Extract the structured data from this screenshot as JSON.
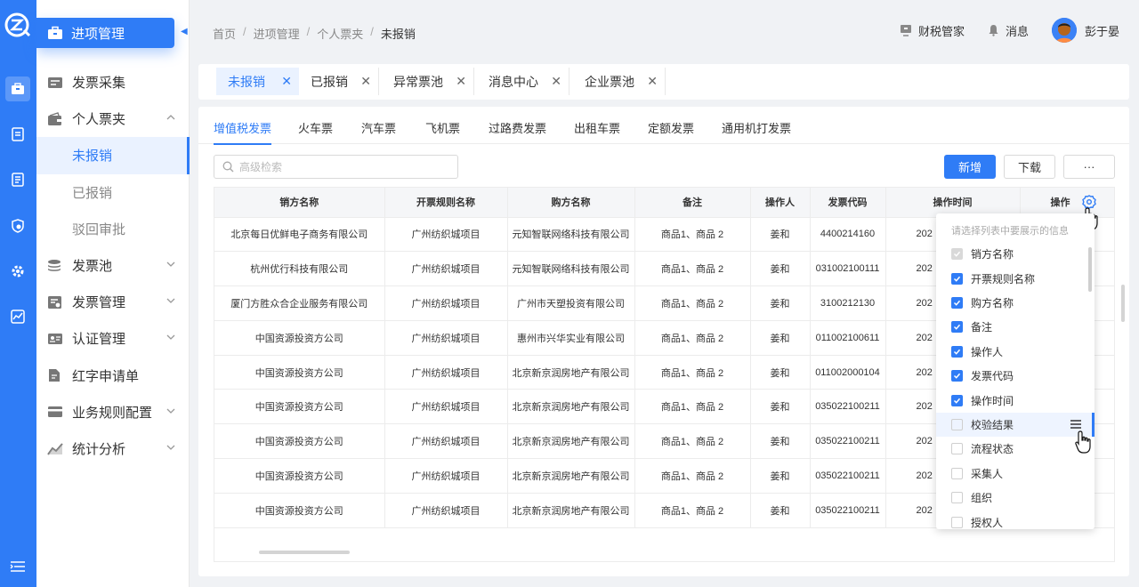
{
  "app": {
    "brand_label": "进项管理"
  },
  "sidebar": {
    "items": [
      {
        "label": "发票采集",
        "icon": "invoice-collect-icon",
        "has_chevron": false
      },
      {
        "label": "个人票夹",
        "icon": "wallet-icon",
        "has_chevron": true,
        "expanded": true
      },
      {
        "label": "未报销",
        "sub": true,
        "active": true
      },
      {
        "label": "已报销",
        "sub": true
      },
      {
        "label": "驳回审批",
        "sub": true
      },
      {
        "label": "发票池",
        "icon": "database-icon",
        "has_chevron": true
      },
      {
        "label": "发票管理",
        "icon": "invoice-manage-icon",
        "has_chevron": true
      },
      {
        "label": "认证管理",
        "icon": "id-card-icon",
        "has_chevron": true
      },
      {
        "label": "红字申请单",
        "icon": "document-icon",
        "has_chevron": false
      },
      {
        "label": "业务规则配置",
        "icon": "card-icon",
        "has_chevron": true
      },
      {
        "label": "统计分析",
        "icon": "chart-icon",
        "has_chevron": true
      }
    ]
  },
  "header": {
    "breadcrumb": [
      "首页",
      "进项管理",
      "个人票夹",
      "未报销"
    ],
    "tax_manager_label": "财税管家",
    "messages_label": "消息",
    "user_name": "彭于晏"
  },
  "page_tabs": [
    "未报销",
    "已报销",
    "异常票池",
    "消息中心",
    "企业票池"
  ],
  "invoice_tabs": [
    "增值税发票",
    "火车票",
    "汽车票",
    "飞机票",
    "过路费发票",
    "出租车票",
    "定额发票",
    "通用机打发票"
  ],
  "toolbar": {
    "search_placeholder": "高级检索",
    "add_label": "新增",
    "download_label": "下载",
    "more_label": "···"
  },
  "table": {
    "headers": [
      "销方名称",
      "开票规则名称",
      "购方名称",
      "备注",
      "操作人",
      "发票代码",
      "操作时间",
      "操作"
    ],
    "rows": [
      [
        "北京每日优鲜电子商务有限公司",
        "广州纺织城项目",
        "元知智联网络科技有限公司",
        "商品1、商品 2",
        "姜和",
        "4400214160",
        "202"
      ],
      [
        "杭州优行科技有限公司",
        "广州纺织城项目",
        "元知智联网络科技有限公司",
        "商品1、商品 2",
        "姜和",
        "031002100111",
        "202"
      ],
      [
        "厦门方胜众合企业服务有限公司",
        "广州纺织城项目",
        "广州市天塑投资有限公司",
        "商品1、商品 2",
        "姜和",
        "3100212130",
        "202"
      ],
      [
        "中国资源投资方公司",
        "广州纺织城项目",
        "惠州市兴华实业有限公司",
        "商品1、商品 2",
        "姜和",
        "011002100611",
        "202"
      ],
      [
        "中国资源投资方公司",
        "广州纺织城项目",
        "北京新京润房地产有限公司",
        "商品1、商品 2",
        "姜和",
        "011002000104",
        "202"
      ],
      [
        "中国资源投资方公司",
        "广州纺织城项目",
        "北京新京润房地产有限公司",
        "商品1、商品 2",
        "姜和",
        "035022100211",
        "202"
      ],
      [
        "中国资源投资方公司",
        "广州纺织城项目",
        "北京新京润房地产有限公司",
        "商品1、商品 2",
        "姜和",
        "035022100211",
        "202"
      ],
      [
        "中国资源投资方公司",
        "广州纺织城项目",
        "北京新京润房地产有限公司",
        "商品1、商品 2",
        "姜和",
        "035022100211",
        "202"
      ],
      [
        "中国资源投资方公司",
        "广州纺织城项目",
        "北京新京润房地产有限公司",
        "商品1、商品 2",
        "姜和",
        "035022100211",
        "202"
      ]
    ]
  },
  "column_picker": {
    "title": "请选择列表中要展示的信息",
    "options": [
      {
        "label": "销方名称",
        "state": "disabled"
      },
      {
        "label": "开票规则名称",
        "state": "checked"
      },
      {
        "label": "购方名称",
        "state": "checked"
      },
      {
        "label": "备注",
        "state": "checked"
      },
      {
        "label": "操作人",
        "state": "checked"
      },
      {
        "label": "发票代码",
        "state": "checked"
      },
      {
        "label": "操作时间",
        "state": "checked"
      },
      {
        "label": "校验结果",
        "state": "unchecked",
        "hover": true
      },
      {
        "label": "流程状态",
        "state": "unchecked"
      },
      {
        "label": "采集人",
        "state": "unchecked"
      },
      {
        "label": "组织",
        "state": "unchecked"
      },
      {
        "label": "授权人",
        "state": "unchecked"
      }
    ]
  },
  "colors": {
    "primary": "#2f7cf6",
    "active_bg": "#eaf2ff"
  }
}
